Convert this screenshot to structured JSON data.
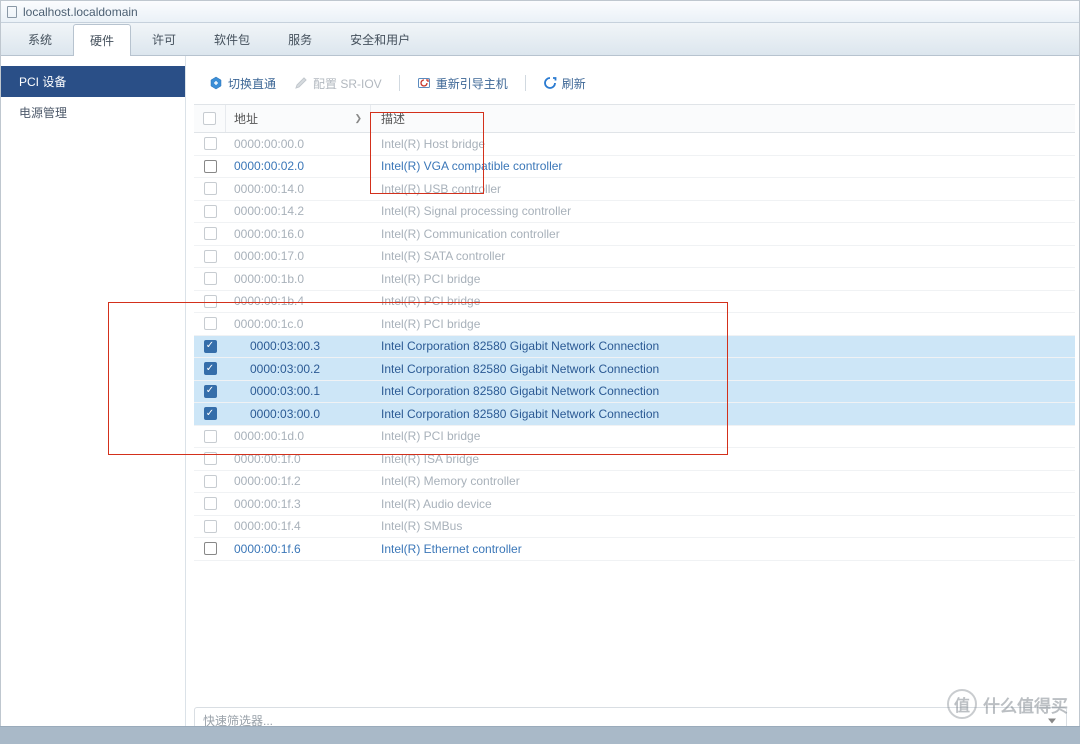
{
  "window": {
    "host": "localhost.localdomain"
  },
  "tabs": {
    "items": [
      "系统",
      "硬件",
      "许可",
      "软件包",
      "服务",
      "安全和用户"
    ],
    "active_index": 1
  },
  "sidebar": {
    "items": [
      {
        "label": "PCI 设备",
        "active": true
      },
      {
        "label": "电源管理",
        "active": false
      }
    ]
  },
  "toolbar": {
    "passthrough_label": "切换直通",
    "sriov_label": "配置 SR-IOV",
    "reboot_label": "重新引导主机",
    "refresh_label": "刷新"
  },
  "grid": {
    "col_address": "地址",
    "col_description": "描述",
    "filter_placeholder": "快速筛选器...",
    "rows": [
      {
        "addr": "0000:00:00.0",
        "desc": "Intel(R) Host bridge",
        "dim": true,
        "checked": false,
        "sel": false,
        "indent": false
      },
      {
        "addr": "0000:00:02.0",
        "desc": "Intel(R) VGA compatible controller",
        "dim": false,
        "checked": false,
        "sel": false,
        "indent": false
      },
      {
        "addr": "0000:00:14.0",
        "desc": "Intel(R) USB controller",
        "dim": true,
        "checked": false,
        "sel": false,
        "indent": false
      },
      {
        "addr": "0000:00:14.2",
        "desc": "Intel(R) Signal processing controller",
        "dim": true,
        "checked": false,
        "sel": false,
        "indent": false
      },
      {
        "addr": "0000:00:16.0",
        "desc": "Intel(R) Communication controller",
        "dim": true,
        "checked": false,
        "sel": false,
        "indent": false
      },
      {
        "addr": "0000:00:17.0",
        "desc": "Intel(R) SATA controller",
        "dim": true,
        "checked": false,
        "sel": false,
        "indent": false
      },
      {
        "addr": "0000:00:1b.0",
        "desc": "Intel(R) PCI bridge",
        "dim": true,
        "checked": false,
        "sel": false,
        "indent": false
      },
      {
        "addr": "0000:00:1b.4",
        "desc": "Intel(R) PCI bridge",
        "dim": true,
        "checked": false,
        "sel": false,
        "indent": false
      },
      {
        "addr": "0000:00:1c.0",
        "desc": "Intel(R) PCI bridge",
        "dim": true,
        "checked": false,
        "sel": false,
        "indent": false
      },
      {
        "addr": "0000:03:00.3",
        "desc": "Intel Corporation 82580 Gigabit Network Connection",
        "dim": false,
        "checked": true,
        "sel": true,
        "indent": true
      },
      {
        "addr": "0000:03:00.2",
        "desc": "Intel Corporation 82580 Gigabit Network Connection",
        "dim": false,
        "checked": true,
        "sel": true,
        "indent": true
      },
      {
        "addr": "0000:03:00.1",
        "desc": "Intel Corporation 82580 Gigabit Network Connection",
        "dim": false,
        "checked": true,
        "sel": true,
        "indent": true
      },
      {
        "addr": "0000:03:00.0",
        "desc": "Intel Corporation 82580 Gigabit Network Connection",
        "dim": false,
        "checked": true,
        "sel": true,
        "indent": true
      },
      {
        "addr": "0000:00:1d.0",
        "desc": "Intel(R) PCI bridge",
        "dim": true,
        "checked": false,
        "sel": false,
        "indent": false
      },
      {
        "addr": "0000:00:1f.0",
        "desc": "Intel(R) ISA bridge",
        "dim": true,
        "checked": false,
        "sel": false,
        "indent": false
      },
      {
        "addr": "0000:00:1f.2",
        "desc": "Intel(R) Memory controller",
        "dim": true,
        "checked": false,
        "sel": false,
        "indent": false
      },
      {
        "addr": "0000:00:1f.3",
        "desc": "Intel(R) Audio device",
        "dim": true,
        "checked": false,
        "sel": false,
        "indent": false
      },
      {
        "addr": "0000:00:1f.4",
        "desc": "Intel(R) SMBus",
        "dim": true,
        "checked": false,
        "sel": false,
        "indent": false
      },
      {
        "addr": "0000:00:1f.6",
        "desc": "Intel(R) Ethernet controller",
        "dim": false,
        "checked": false,
        "sel": false,
        "indent": false
      }
    ]
  },
  "watermark": {
    "text": "什么值得买",
    "glyph": "值"
  }
}
